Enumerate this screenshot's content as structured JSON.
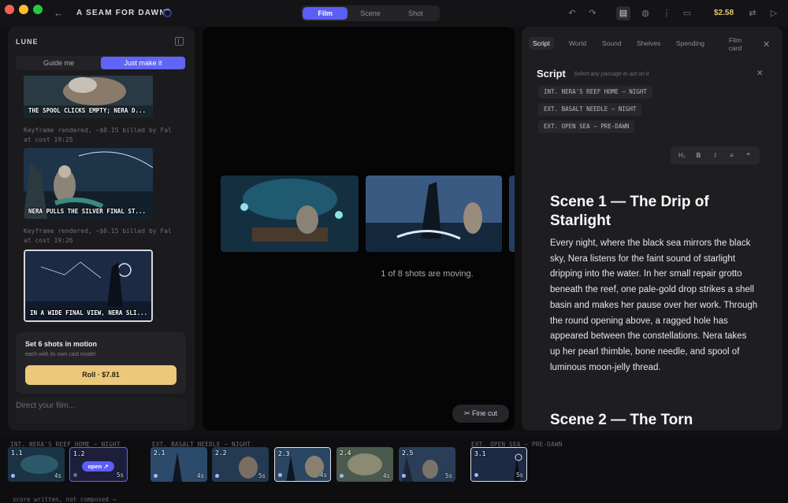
{
  "app": {
    "title": "A SEAM FOR DAWN",
    "balance": "$2.58"
  },
  "mode_tabs": [
    "Film",
    "Scene",
    "Shot"
  ],
  "left_panel": {
    "title": "LUNE",
    "segments": [
      "Guide me",
      "Just make it"
    ],
    "feed": [
      {
        "caption": "THE SPOOL CLICKS EMPTY; NERA D..."
      },
      {
        "note": "Keyframe rendered, ~$0.15 billed by Fal at cost 19:25"
      },
      {
        "caption": "NERA PULLS THE SILVER FINAL ST..."
      },
      {
        "note": "Keyframe rendered, ~$0.15 billed by Fal at cost 19:26"
      },
      {
        "caption": "IN A WIDE FINAL VIEW, NERA SLI..."
      }
    ],
    "motion_card": {
      "title": "Set 6 shots in motion",
      "subtitle": "each with its own cast model",
      "roll_label": "Roll · $7.81"
    },
    "direct_placeholder": "Direct your film..."
  },
  "center": {
    "status": "1 of 8 shots are moving.",
    "fine_cut_label": "Fine cut"
  },
  "right_panel": {
    "tabs": [
      "Script",
      "World",
      "Sound",
      "Shelves",
      "Spending",
      "Film card"
    ],
    "script_title": "Script",
    "script_hint": "Select any passage to act on it",
    "sluglines": [
      "INT. NERA'S REEF HOME — NIGHT",
      "EXT. BASALT NEEDLE — NIGHT",
      "EXT. OPEN SEA — PRE-DAWN"
    ],
    "format_buttons": [
      "H₂",
      "B",
      "I",
      "≡",
      "❝"
    ],
    "scene1_title": "Scene 1 — The Drip of Starlight",
    "scene1_body": "Every night, where the black sea mirrors the black sky, Nera listens for the faint sound of starlight dripping into the water. In her small repair grotto beneath the reef, one pale-gold drop strikes a shell basin and makes her pause over her work. Through the round opening above, a ragged hole has appeared between the constellations. Nera takes up her pearl thimble, bone needle, and spool of luminous moon-jelly thread.",
    "scene2_title": "Scene 2 — The Torn"
  },
  "timeline": {
    "groups": [
      {
        "heading": "INT. NERA'S REEF HOME — NIGHT",
        "clips": [
          {
            "num": "1.1",
            "dur": "4s"
          },
          {
            "num": "1.2",
            "dur": "5s",
            "action": "open ↗"
          }
        ]
      },
      {
        "heading": "EXT. BASALT NEEDLE — NIGHT",
        "clips": [
          {
            "num": "2.1",
            "dur": "4s"
          },
          {
            "num": "2.2",
            "dur": "5s"
          },
          {
            "num": "2.3",
            "dur": "4s"
          },
          {
            "num": "2.4",
            "dur": "4s"
          },
          {
            "num": "2.5",
            "dur": "5s"
          }
        ]
      },
      {
        "heading": "EXT. OPEN SEA — PRE-DAWN",
        "clips": [
          {
            "num": "3.1",
            "dur": "5s"
          }
        ]
      }
    ],
    "footer": "score written, not composed →"
  },
  "colors": {
    "accent": "#5b5ef5",
    "roll": "#ecc87a",
    "balance": "#e8c66a"
  },
  "icons": [
    "back-arrow-icon",
    "undo-icon",
    "redo-icon",
    "script-icon",
    "palette-icon",
    "waveform-icon",
    "folder-icon",
    "settings-icon",
    "play-icon",
    "close-icon",
    "scissors-icon"
  ]
}
